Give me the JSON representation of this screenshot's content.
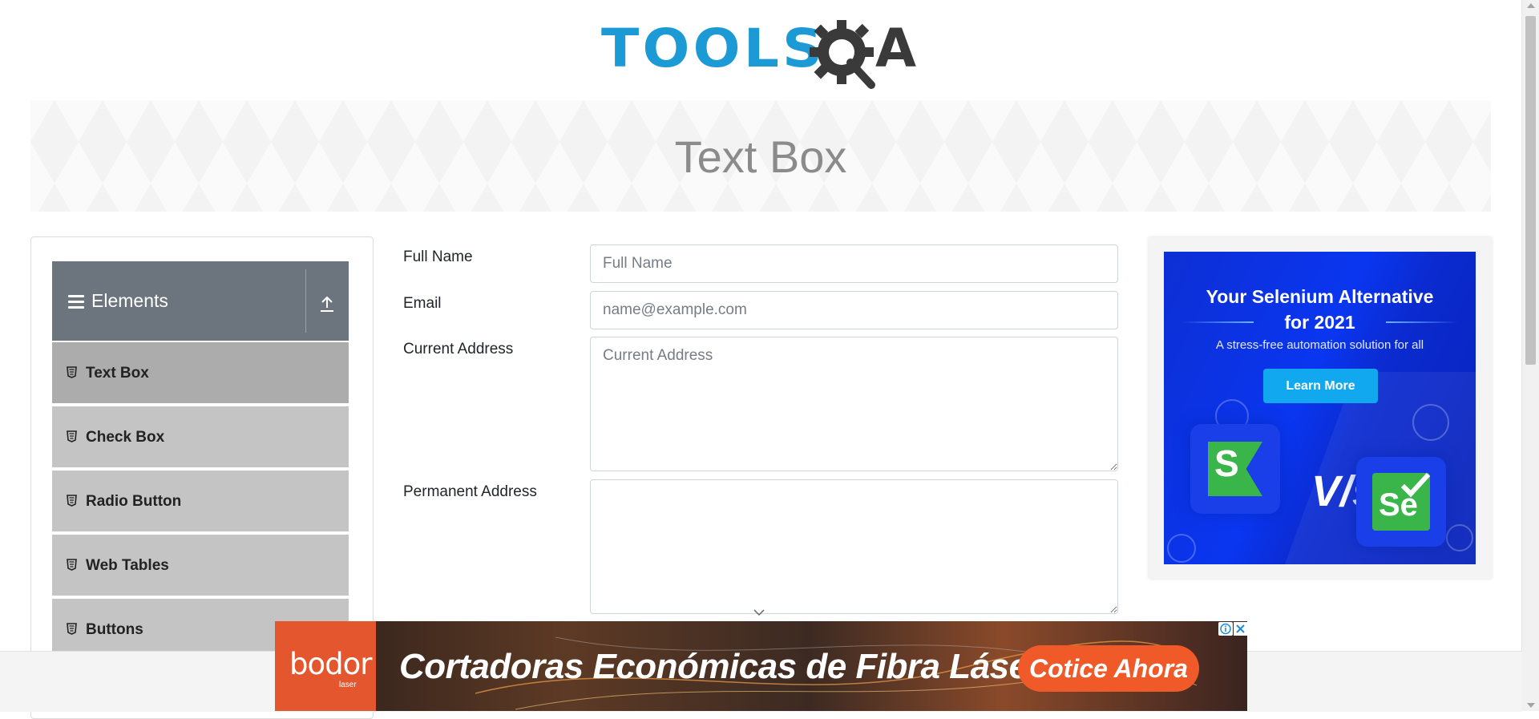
{
  "header": {
    "logo_text": "TOOLS",
    "logo_a": "A",
    "logo_icon": "gear-magnifier-icon"
  },
  "banner": {
    "title": "Text Box"
  },
  "sidebar": {
    "group_title": "Elements",
    "group_icon": "hamburger-icon",
    "collapse_icon": "upload-arrow-icon",
    "items": [
      {
        "label": "Text Box",
        "active": true,
        "icon": "html5-icon"
      },
      {
        "label": "Check Box",
        "active": false,
        "icon": "html5-icon"
      },
      {
        "label": "Radio Button",
        "active": false,
        "icon": "html5-icon"
      },
      {
        "label": "Web Tables",
        "active": false,
        "icon": "html5-icon"
      },
      {
        "label": "Buttons",
        "active": false,
        "icon": "html5-icon"
      }
    ]
  },
  "form": {
    "full_name": {
      "label": "Full Name",
      "placeholder": "Full Name",
      "value": ""
    },
    "email": {
      "label": "Email",
      "placeholder": "name@example.com",
      "value": ""
    },
    "current_address": {
      "label": "Current Address",
      "placeholder": "Current Address",
      "value": ""
    },
    "permanent_address": {
      "label": "Permanent Address",
      "placeholder": "",
      "value": ""
    }
  },
  "side_ad": {
    "headline_line1": "Your Selenium Alternative",
    "headline_line2": "for 2021",
    "subtitle": "A stress-free automation solution for all",
    "button": "Learn More",
    "vs": "V/s",
    "left_logo": "S",
    "right_logo": "Se",
    "colors": {
      "bg": "#0a36f0",
      "button": "#12a8ef",
      "green": "#3ab54a"
    }
  },
  "footer_ad": {
    "brand": "bodor",
    "brand_sub": "laser",
    "headline": "Cortadoras Económicas de Fibra Láser",
    "cta": "Cotice Ahora",
    "colors": {
      "brand_bg": "#e4572e",
      "cta_bg": "#f05a28"
    }
  }
}
